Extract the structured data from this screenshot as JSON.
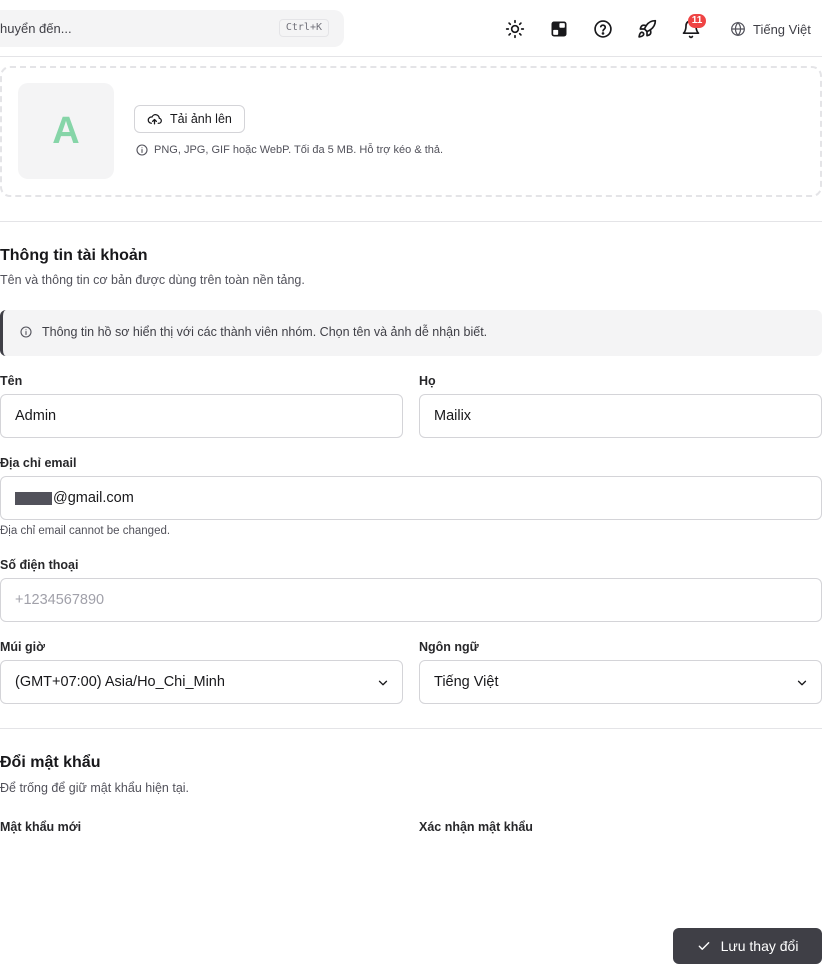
{
  "topbar": {
    "search_placeholder": "huyển đến...",
    "search_shortcut": "Ctrl+K",
    "icons": [
      "sun-icon",
      "layout-icon",
      "help-circle-icon",
      "rocket-icon",
      "bell-icon",
      "globe-icon"
    ],
    "notification_count": "11",
    "language_label": "Tiếng Việt"
  },
  "avatar": {
    "initial": "A",
    "upload_label": "Tải ảnh lên",
    "hint": "PNG, JPG, GIF hoặc WebP. Tối đa 5 MB. Hỗ trợ kéo & thả."
  },
  "account": {
    "title": "Thông tin tài khoản",
    "description": "Tên và thông tin cơ bản được dùng trên toàn nền tảng.",
    "banner": "Thông tin hồ sơ hiển thị với các thành viên nhóm. Chọn tên và ảnh dễ nhận biết.",
    "first_name_label": "Tên",
    "first_name_value": "Admin",
    "last_name_label": "Họ",
    "last_name_value": "Mailix",
    "email_label": "Địa chỉ email",
    "email_value": "@gmail.com",
    "email_help": "Địa chỉ email cannot be changed.",
    "phone_label": "Số điện thoại",
    "phone_placeholder": "+1234567890",
    "timezone_label": "Múi giờ",
    "timezone_value": "(GMT+07:00) Asia/Ho_Chi_Minh",
    "language_label": "Ngôn ngữ",
    "language_value": "Tiếng Việt"
  },
  "password": {
    "title": "Đổi mật khẩu",
    "description": "Để trống để giữ mật khẩu hiện tại.",
    "new_label": "Mật khẩu mới",
    "confirm_label": "Xác nhận mật khẩu"
  },
  "actions": {
    "save_label": "Lưu thay đổi"
  },
  "colors": {
    "accent": "#3f3f46",
    "badge": "#ef4444",
    "avatar_initial": "#86d5a8"
  }
}
